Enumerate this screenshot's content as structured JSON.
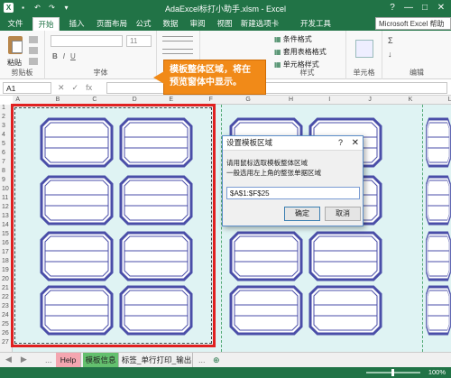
{
  "window": {
    "title": "AdaExcel标打小助手.xlsm - Excel",
    "controls": [
      "?",
      "—",
      "□",
      "✕"
    ]
  },
  "ribbon": {
    "file_tab": "文件",
    "tabs": [
      "开始",
      "插入",
      "页面布局",
      "公式",
      "数据",
      "审阅",
      "视图",
      "新建选项卡",
      "开发工具"
    ],
    "active_tab": "开始",
    "search_placeholder": "Microsoft Excel 帮助",
    "groups": {
      "clipboard": "剪贴板",
      "paste": "粘贴",
      "font": "字体",
      "font_size": "11",
      "bold": "B",
      "italic": "I",
      "underline": "U",
      "styles": "样式",
      "conditional_format": "条件格式",
      "table_format": "套用表格格式",
      "cell_styles": "单元格样式",
      "cells": "单元格",
      "editing": "编辑"
    }
  },
  "formula_bar": {
    "name_box": "A1",
    "cancel": "✕",
    "enter": "✓",
    "fx": "fx"
  },
  "sheet": {
    "columns": [
      "A",
      "B",
      "C",
      "D",
      "E",
      "F",
      "G",
      "H",
      "I",
      "J",
      "K",
      "L"
    ],
    "rows": [
      "1",
      "2",
      "3",
      "4",
      "5",
      "6",
      "7",
      "8",
      "9",
      "10",
      "11",
      "12",
      "13",
      "14",
      "15",
      "16",
      "17",
      "18",
      "19",
      "20",
      "21",
      "22",
      "23",
      "24",
      "25",
      "26",
      "27"
    ]
  },
  "callout": {
    "line1": "模板整体区域，将在",
    "line2": "预览窗体中显示。"
  },
  "dialog": {
    "title": "设置模板区域",
    "help": "?",
    "close": "✕",
    "instruction1": "请用鼠标选取模板整体区域",
    "instruction2": "一般选用左上角的整张单据区域",
    "range_value": "$A$1:$F$25",
    "ok": "确定",
    "cancel": "取消"
  },
  "sheet_tabs": {
    "nav_prev": "◀",
    "nav_next": "▶",
    "more": "...",
    "tabs": [
      {
        "label": "Help",
        "color": "#f4a6b0"
      },
      {
        "label": "模板信息",
        "color": "#63c06e"
      },
      {
        "label": "标签_单行打印_输出",
        "color": "#f0f0f0"
      }
    ],
    "add": "⊕"
  },
  "status_bar": {
    "zoom": "100%"
  },
  "colors": {
    "excel_green": "#217346",
    "highlight_red": "#e02020",
    "callout_orange": "#f18a18",
    "label_border": "#4a4ea8",
    "preview_bg": "#dff3f3"
  }
}
